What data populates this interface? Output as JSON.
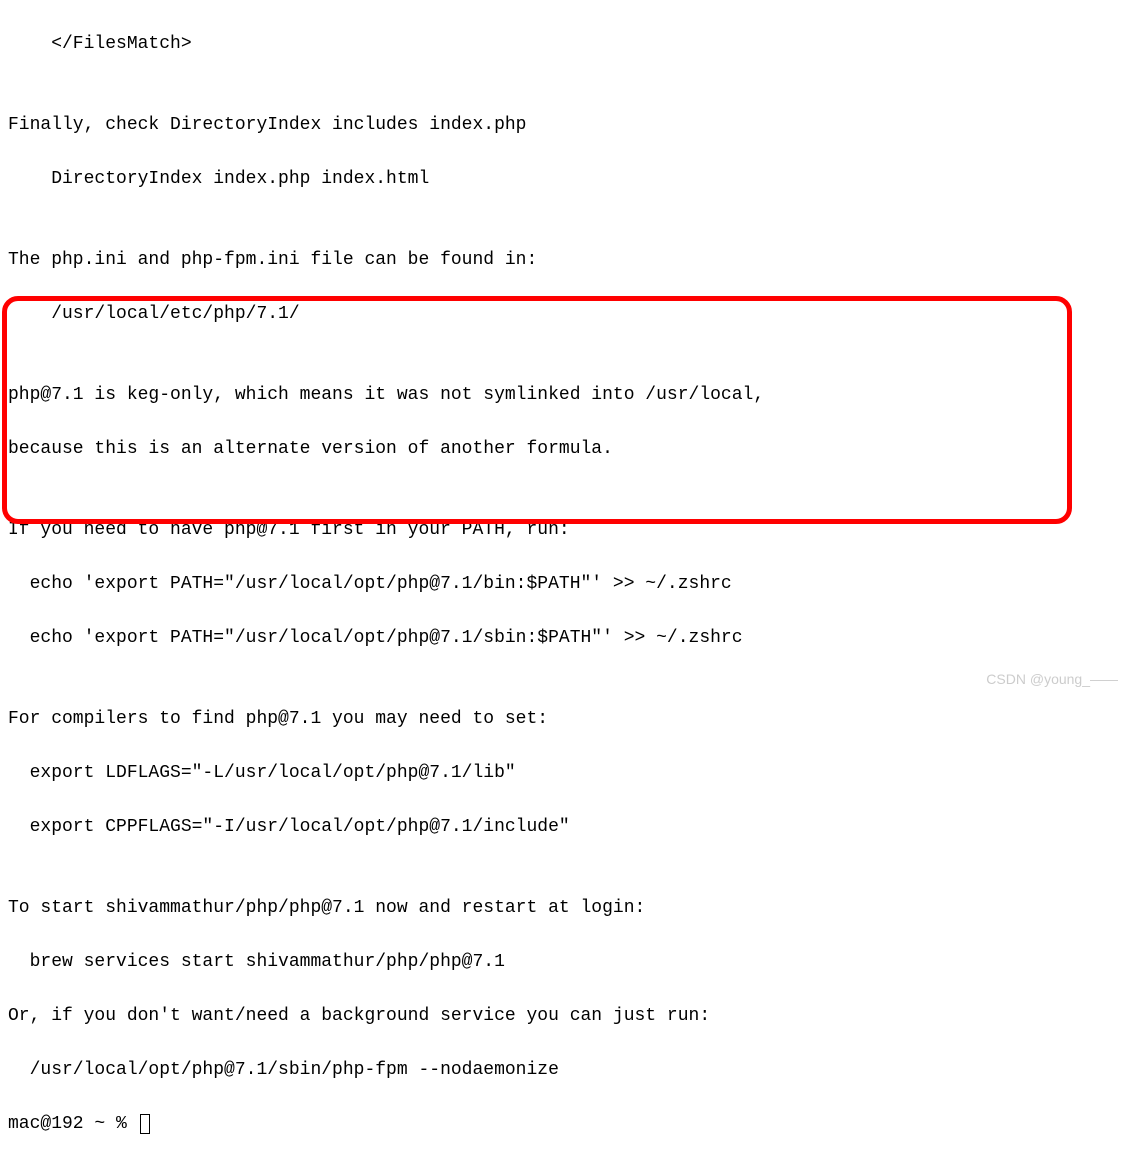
{
  "terminal": {
    "lines": [
      "    </FilesMatch>",
      "",
      "Finally, check DirectoryIndex includes index.php",
      "    DirectoryIndex index.php index.html",
      "",
      "The php.ini and php-fpm.ini file can be found in:",
      "    /usr/local/etc/php/7.1/",
      "",
      "php@7.1 is keg-only, which means it was not symlinked into /usr/local,",
      "because this is an alternate version of another formula.",
      "",
      "If you need to have php@7.1 first in your PATH, run:",
      "  echo 'export PATH=\"/usr/local/opt/php@7.1/bin:$PATH\"' >> ~/.zshrc",
      "  echo 'export PATH=\"/usr/local/opt/php@7.1/sbin:$PATH\"' >> ~/.zshrc",
      "",
      "For compilers to find php@7.1 you may need to set:",
      "  export LDFLAGS=\"-L/usr/local/opt/php@7.1/lib\"",
      "  export CPPFLAGS=\"-I/usr/local/opt/php@7.1/include\"",
      "",
      "To start shivammathur/php/php@7.1 now and restart at login:",
      "  brew services start shivammathur/php/php@7.1",
      "Or, if you don't want/need a background service you can just run:",
      "  /usr/local/opt/php@7.1/sbin/php-fpm --nodaemonize"
    ],
    "prompt": "mac@192 ~ % "
  },
  "watermark": "CSDN @young_——"
}
